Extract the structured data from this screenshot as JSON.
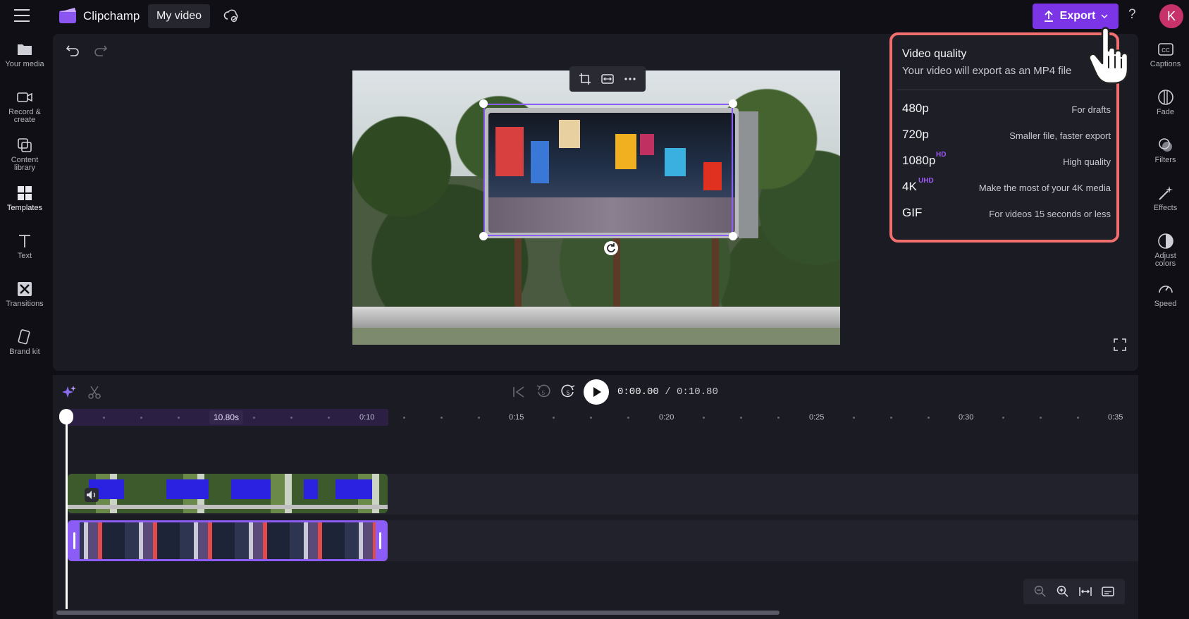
{
  "topbar": {
    "app_name": "Clipchamp",
    "project_name": "My video",
    "export_label": "Export",
    "avatar_initial": "K",
    "help": "?"
  },
  "left_sidebar": [
    {
      "label": "Your media",
      "icon": "folder-icon"
    },
    {
      "label": "Record &\ncreate",
      "icon": "camera-icon"
    },
    {
      "label": "Content\nlibrary",
      "icon": "library-icon"
    },
    {
      "label": "Templates",
      "icon": "templates-icon",
      "active": true
    },
    {
      "label": "Text",
      "icon": "text-icon"
    },
    {
      "label": "Transitions",
      "icon": "transitions-icon"
    },
    {
      "label": "Brand kit",
      "icon": "brand-kit-icon"
    }
  ],
  "right_sidebar": [
    {
      "label": "Captions",
      "icon": "captions-icon"
    },
    {
      "label": "Fade",
      "icon": "fade-icon"
    },
    {
      "label": "Filters",
      "icon": "filters-icon"
    },
    {
      "label": "Effects",
      "icon": "effects-icon"
    },
    {
      "label": "Adjust\ncolors",
      "icon": "adjust-colors-icon"
    },
    {
      "label": "Speed",
      "icon": "speed-icon"
    }
  ],
  "export_menu": {
    "title": "Video quality",
    "subtitle": "Your video will export as an MP4 file",
    "options": [
      {
        "label": "480p",
        "badge": "",
        "description": "For drafts"
      },
      {
        "label": "720p",
        "badge": "",
        "description": "Smaller file, faster export"
      },
      {
        "label": "1080p",
        "badge": "HD",
        "description": "High quality"
      },
      {
        "label": "4K",
        "badge": "UHD",
        "description": "Make the most of your 4K media"
      },
      {
        "label": "GIF",
        "badge": "",
        "description": "For videos 15 seconds or less"
      }
    ]
  },
  "playback": {
    "current_time": "0:00.00",
    "duration": "0:10.80",
    "rewind_seconds": "5",
    "forward_seconds": "5"
  },
  "timeline": {
    "selection_length": "10.80s",
    "ticks": [
      "0:10",
      "0:15",
      "0:20",
      "0:25",
      "0:30",
      "0:35"
    ]
  },
  "colors": {
    "accent": "#7b34e6",
    "highlight_border": "#f06e6e",
    "badge": "#9d5cf5"
  }
}
